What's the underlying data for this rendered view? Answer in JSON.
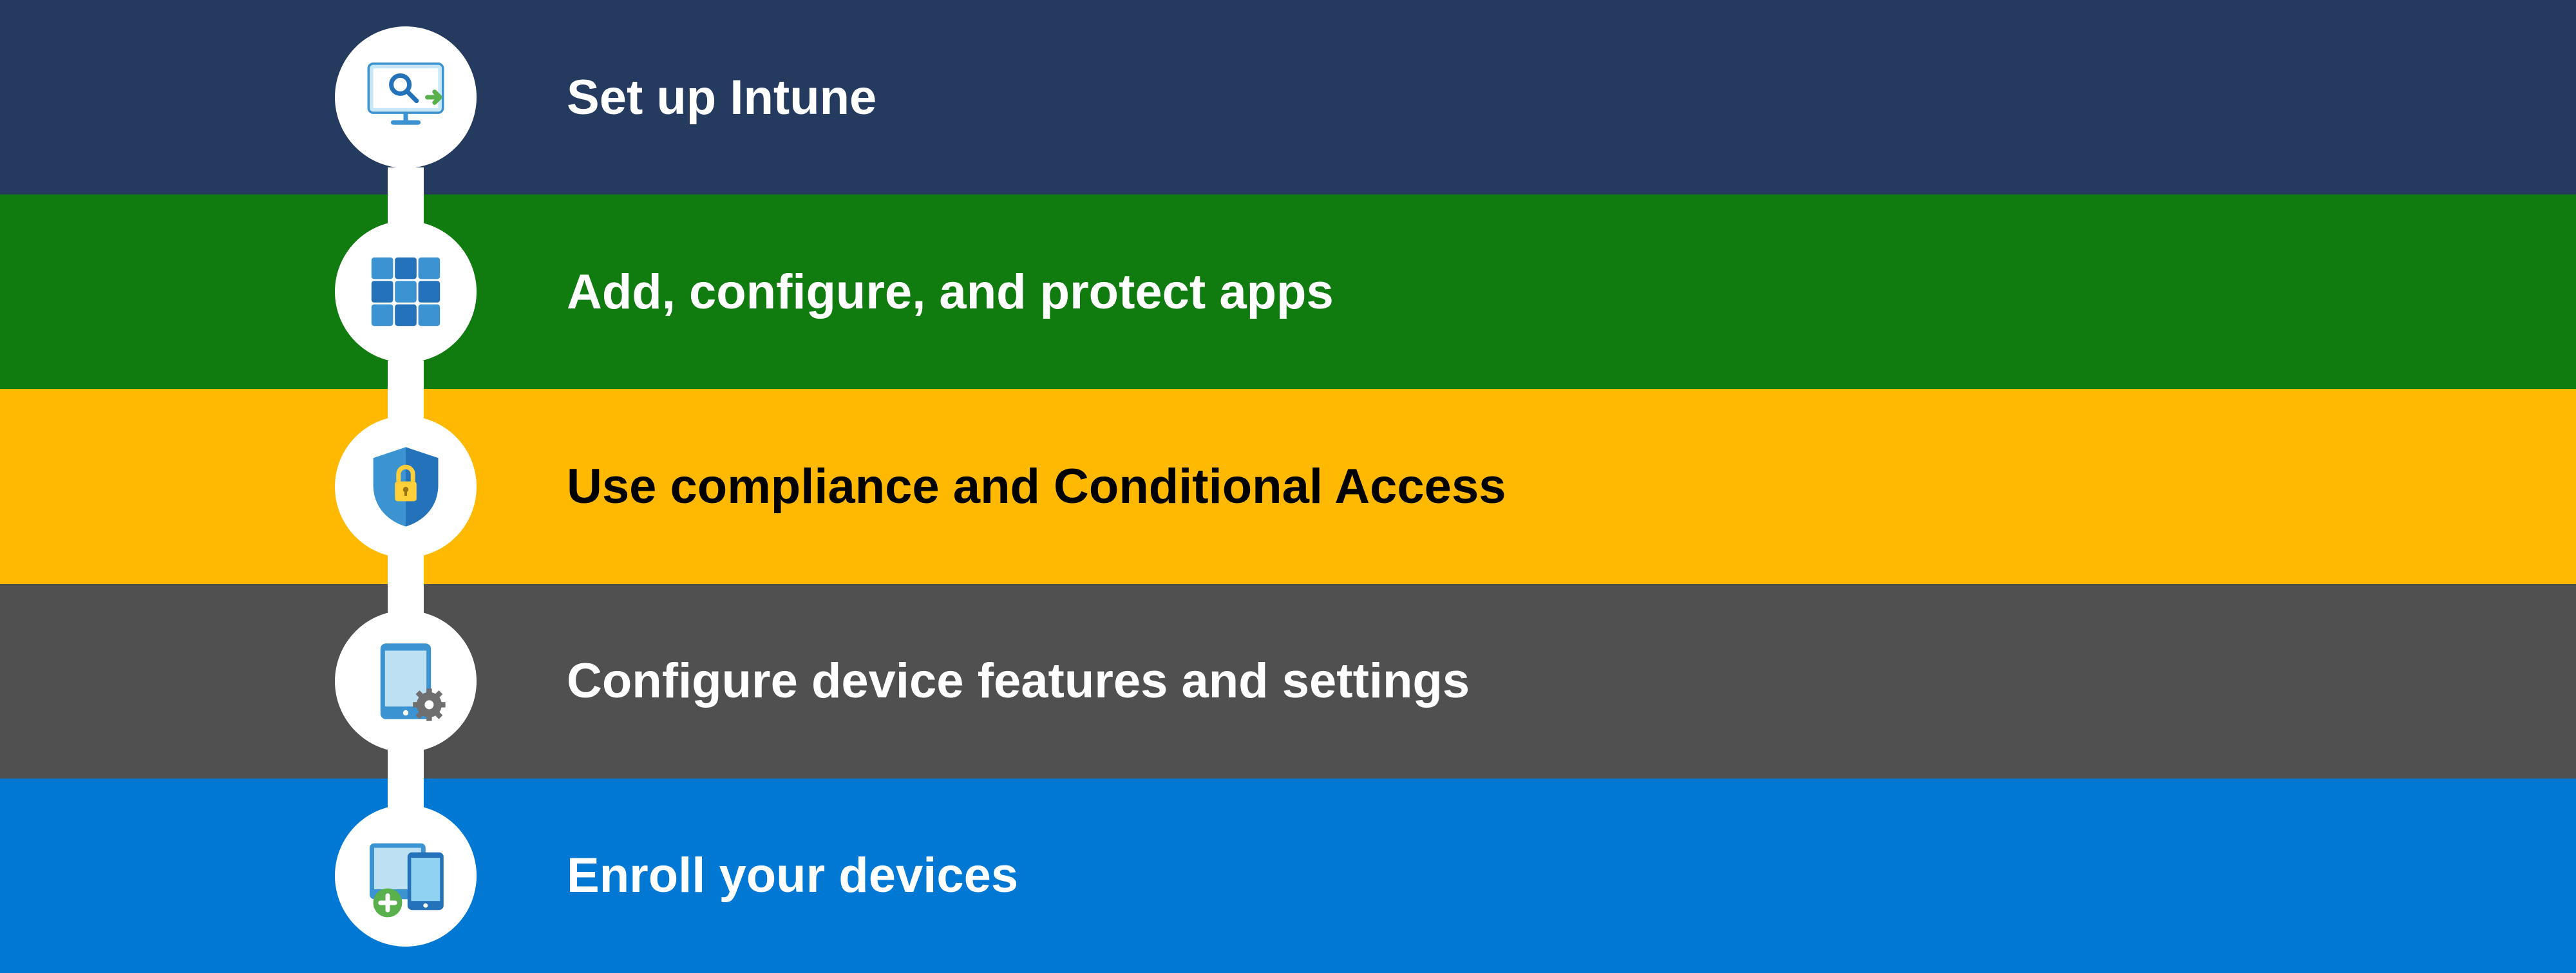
{
  "steps": [
    {
      "label": "Set up Intune",
      "bg_color": "#243a5e",
      "text_color": "#ffffff",
      "icon": "monitor-setup-icon"
    },
    {
      "label": "Add, configure, and protect apps",
      "bg_color": "#107c10",
      "text_color": "#ffffff",
      "icon": "apps-grid-icon"
    },
    {
      "label": "Use compliance and Conditional Access",
      "bg_color": "#ffb900",
      "text_color": "#000000",
      "icon": "shield-lock-icon"
    },
    {
      "label": "Configure device features and settings",
      "bg_color": "#505050",
      "text_color": "#ffffff",
      "icon": "tablet-gear-icon"
    },
    {
      "label": "Enroll your devices",
      "bg_color": "#0078d4",
      "text_color": "#ffffff",
      "icon": "devices-add-icon"
    }
  ],
  "colors": {
    "icon_primary": "#3b93d1",
    "icon_dark": "#2372ba",
    "icon_light": "#8fd2f2",
    "circle_bg": "#ffffff",
    "add_badge": "#59b04d",
    "lock_yellow": "#ffcf3a"
  }
}
